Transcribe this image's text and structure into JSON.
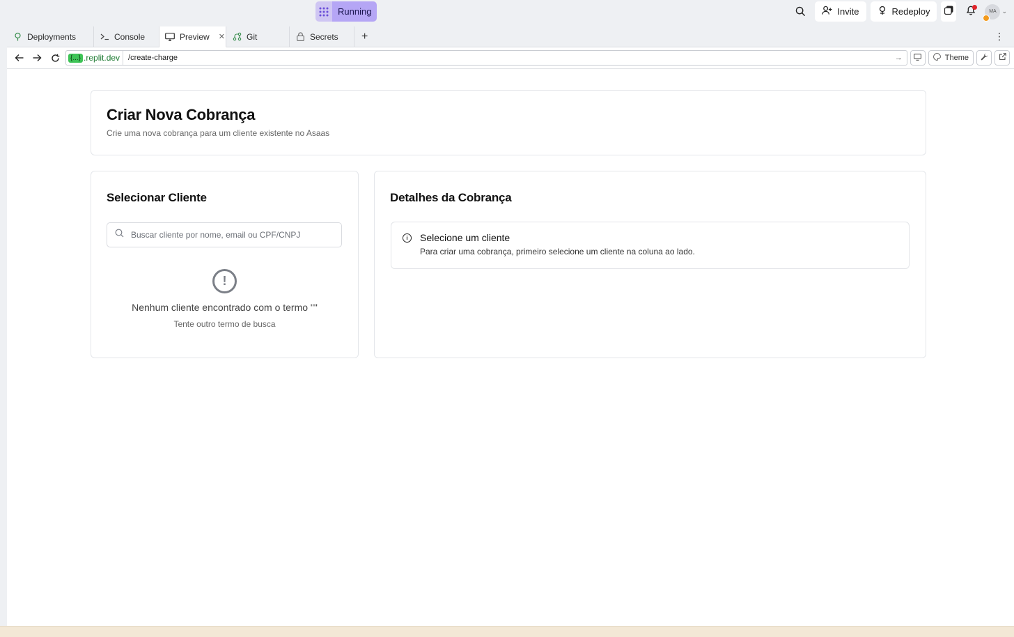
{
  "topbar": {
    "run_label": "Running",
    "invite_label": "Invite",
    "redeploy_label": "Redeploy",
    "avatar_initials": "MA"
  },
  "tabs": [
    {
      "label": "Deployments",
      "icon": "deployments-icon"
    },
    {
      "label": "Console",
      "icon": "console-icon"
    },
    {
      "label": "Preview",
      "icon": "monitor-icon",
      "active": true
    },
    {
      "label": "Git",
      "icon": "git-icon"
    },
    {
      "label": "Secrets",
      "icon": "lock-icon"
    }
  ],
  "urlbar": {
    "domain_badge": "{...}",
    "domain": ".replit.dev",
    "path": "/create-charge",
    "theme_label": "Theme"
  },
  "page": {
    "title": "Criar Nova Cobrança",
    "subtitle": "Crie uma nova cobrança para um cliente existente no Asaas"
  },
  "client_panel": {
    "title": "Selecionar Cliente",
    "search_placeholder": "Buscar cliente por nome, email ou CPF/CNPJ",
    "search_value": "",
    "empty_title": "Nenhum cliente encontrado com o termo \"\"",
    "empty_subtitle": "Tente outro termo de busca"
  },
  "charge_panel": {
    "title": "Detalhes da Cobrança",
    "alert_title": "Selecione um cliente",
    "alert_text": "Para criar uma cobrança, primeiro selecione um cliente na coluna ao lado."
  },
  "colors": {
    "running_accent": "#b5a6f5",
    "domain_green": "#3ec457",
    "notification_dot": "#e0242b"
  }
}
